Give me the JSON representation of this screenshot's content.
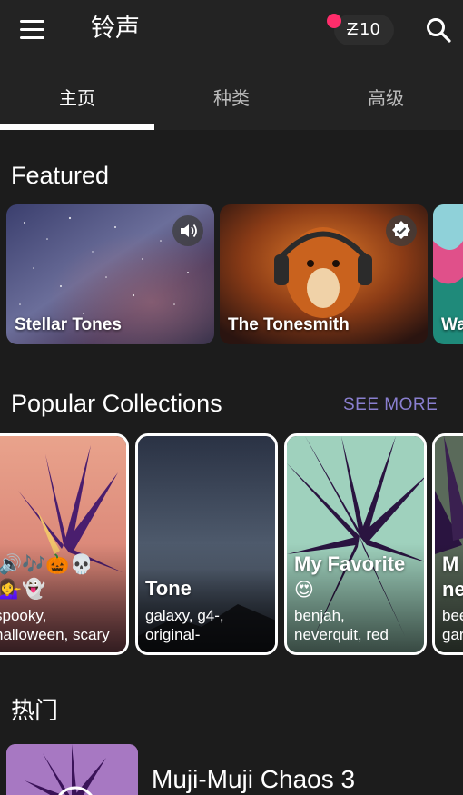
{
  "app_bar": {
    "title": "铃声",
    "coin_symbol": "Z",
    "coin_count": "10",
    "icons": [
      "menu-icon",
      "coin-icon",
      "search-icon"
    ],
    "notification_color": "#ff2d6b"
  },
  "tabs": [
    {
      "label": "主页",
      "active": true
    },
    {
      "label": "种类",
      "active": false
    },
    {
      "label": "高级",
      "active": false
    }
  ],
  "featured": {
    "title": "Featured",
    "cards": [
      {
        "label": "Stellar Tones",
        "badge_icon": "speaker-icon"
      },
      {
        "label": "The Tonesmith",
        "badge_icon": "verified-icon"
      },
      {
        "label": "Wa"
      }
    ]
  },
  "popular_collections": {
    "title": "Popular Collections",
    "see_more": "SEE MORE",
    "cards": [
      {
        "emoji_line1": "🔊🎶🎃💀",
        "emoji_line2": "💁‍♀️👻",
        "tags_line1": "spooky,",
        "tags_line2": "halloween, scary"
      },
      {
        "title": "Tone",
        "tags_line1": "galaxy, g4-,",
        "tags_line2": "original-"
      },
      {
        "title": "My Favorite",
        "emoji_line1": "😍",
        "tags_line1": "benjah,",
        "tags_line2": "neverquit, red"
      },
      {
        "title_line1": "M",
        "title_line2": "ne",
        "tags_line1": "bee",
        "tags_line2": "gar"
      }
    ]
  },
  "hot": {
    "title": "热门",
    "items": [
      {
        "name": "Muji-Muji Chaos 3"
      }
    ]
  },
  "colors": {
    "background": "#1c1c1c",
    "app_bar": "#232323",
    "accent_link": "#8a7fd0",
    "tab_indicator": "#ffffff"
  }
}
